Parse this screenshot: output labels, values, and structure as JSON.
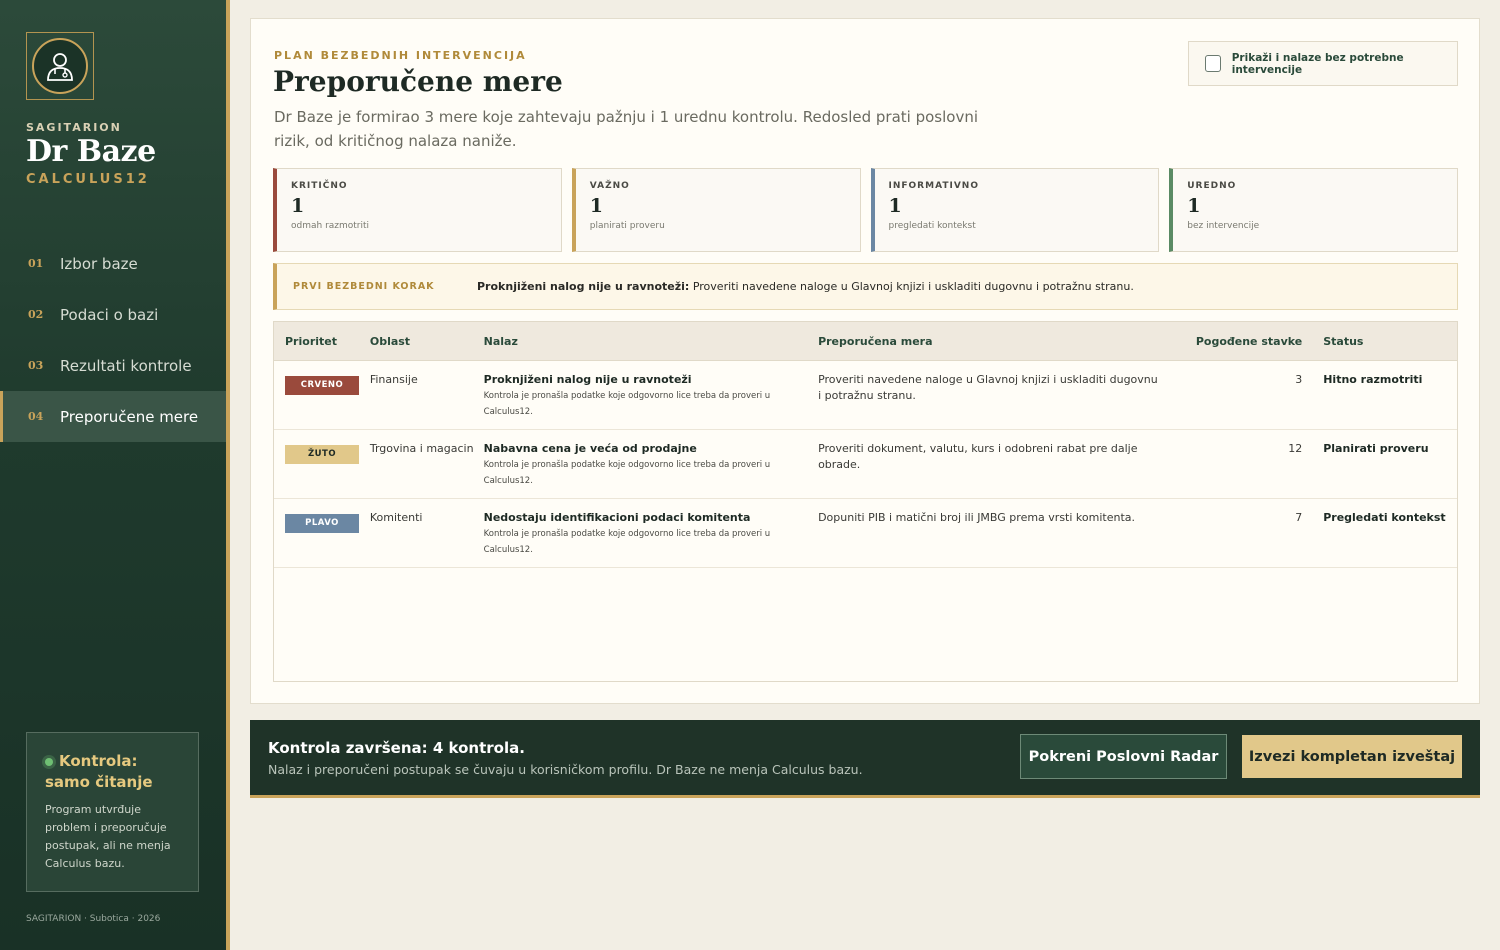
{
  "brand": {
    "kicker": "SAGITARION",
    "title": "Dr Baze",
    "subtitle": "CALCULUS12",
    "logo_icon": "doctor-icon"
  },
  "nav": [
    {
      "num": "01",
      "label": "Izbor baze",
      "active": false
    },
    {
      "num": "02",
      "label": "Podaci o bazi",
      "active": false
    },
    {
      "num": "03",
      "label": "Rezultati kontrole",
      "active": false
    },
    {
      "num": "04",
      "label": "Preporučene mere",
      "active": true
    }
  ],
  "sidebar_status": {
    "title": "Kontrola: samo čitanje",
    "text": "Program utvrđuje problem i preporučuje postupak, ali ne menja Calculus bazu."
  },
  "footer_note": "SAGITARION · Subotica · 2026",
  "header": {
    "kicker": "PLAN BEZBEDNIH INTERVENCIJA",
    "title": "Preporučene mere",
    "description": "Dr Baze je formirao 3 mere koje zahtevaju pažnju i 1 urednu kontrolu. Redosled prati poslovni rizik, od kritičnog nalaza naniže."
  },
  "toggle": {
    "label": "Prikaži i nalaze bez potrebne intervencije",
    "checked": false
  },
  "stats": [
    {
      "label": "KRITIČNO",
      "value": "1",
      "note": "odmah razmotriti",
      "color": "#9a4a3c"
    },
    {
      "label": "VAŽNO",
      "value": "1",
      "note": "planirati proveru",
      "color": "#c9a35a"
    },
    {
      "label": "INFORMATIVNO",
      "value": "1",
      "note": "pregledati kontekst",
      "color": "#6b87a3"
    },
    {
      "label": "UREDNO",
      "value": "1",
      "note": "bez intervencije",
      "color": "#5a8a64"
    }
  ],
  "first_step": {
    "label": "PRVI BEZBEDNI KORAK",
    "title": "Proknjiženi nalog nije u ravnoteži:",
    "text": " Proveriti navedene naloge u Glavnoj knjizi i uskladiti dugovnu i potražnu stranu."
  },
  "table": {
    "headers": [
      "Prioritet",
      "Oblast",
      "Nalaz",
      "Preporučena mera",
      "Pogođene stavke",
      "Status"
    ],
    "rows": [
      {
        "priority": "CRVENO",
        "badge_bg": "#9a4a3c",
        "badge_fg": "#ffffff",
        "area": "Finansije",
        "finding": "Proknjiženi nalog nije u ravnoteži",
        "finding_note": "Kontrola je pronašla podatke koje odgovorno lice treba da proveri u Calculus12.",
        "action": "Proveriti navedene naloge u Glavnoj knjizi i uskladiti dugovnu i potražnu stranu.",
        "count": "3",
        "status": "Hitno razmotriti"
      },
      {
        "priority": "ŽUTO",
        "badge_bg": "#e1c88a",
        "badge_fg": "#1e2a24",
        "area": "Trgovina i magacin",
        "finding": "Nabavna cena je veća od prodajne",
        "finding_note": "Kontrola je pronašla podatke koje odgovorno lice treba da proveri u Calculus12.",
        "action": "Proveriti dokument, valutu, kurs i odobreni rabat pre dalje obrade.",
        "count": "12",
        "status": "Planirati proveru"
      },
      {
        "priority": "PLAVO",
        "badge_bg": "#6b87a3",
        "badge_fg": "#ffffff",
        "area": "Komitenti",
        "finding": "Nedostaju identifikacioni podaci komitenta",
        "finding_note": "Kontrola je pronašla podatke koje odgovorno lice treba da proveri u Calculus12.",
        "action": "Dopuniti PIB i matični broj ili JMBG prema vrsti komitenta.",
        "count": "7",
        "status": "Pregledati kontekst"
      }
    ]
  },
  "bottom_bar": {
    "title": "Kontrola završena: 4 kontrola.",
    "subtitle": "Nalaz i preporučeni postupak se čuvaju u korisničkom profilu. Dr Baze ne menja Calculus bazu.",
    "radar_button": "Pokreni Poslovni Radar",
    "export_button": "Izvezi kompletan izveštaj"
  }
}
